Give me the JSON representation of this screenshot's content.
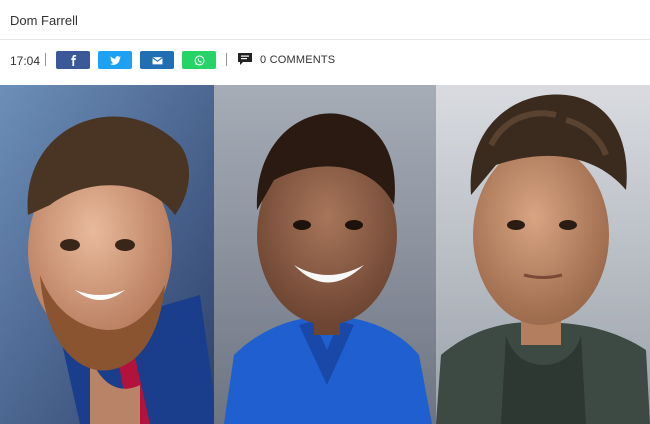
{
  "article": {
    "author": "Dom Farrell",
    "time": "17:04",
    "comments_label": "0 COMMENTS"
  },
  "share": [
    {
      "network": "facebook",
      "icon": "facebook-icon",
      "color": "#3b5998"
    },
    {
      "network": "twitter",
      "icon": "twitter-icon",
      "color": "#1da1f2"
    },
    {
      "network": "email",
      "icon": "email-icon",
      "color": "#1f6fb2"
    },
    {
      "network": "whatsapp",
      "icon": "whatsapp-icon",
      "color": "#25d366"
    }
  ],
  "photos": [
    {
      "subject": "player-left",
      "jersey_color": "#1a3e8c"
    },
    {
      "subject": "player-center",
      "jersey_color": "#1f5fd0"
    },
    {
      "subject": "player-right",
      "jersey_color": "#3d4a44"
    }
  ]
}
